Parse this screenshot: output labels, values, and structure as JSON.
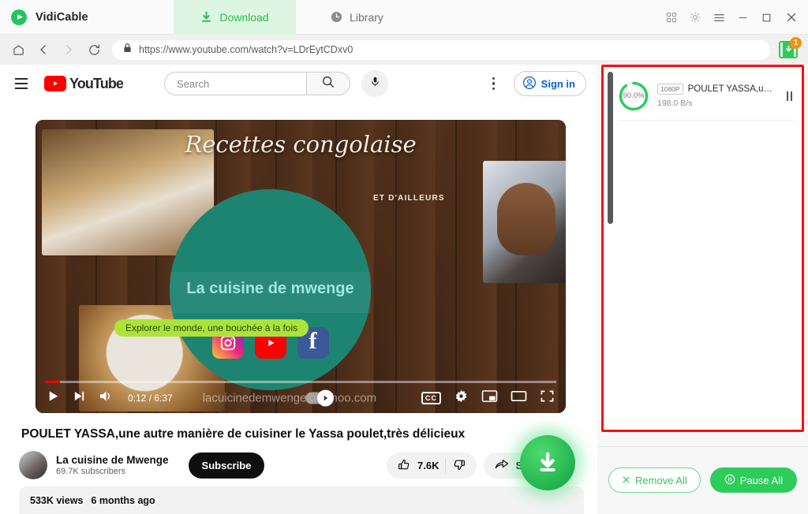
{
  "app": {
    "name": "VidiCable",
    "logo_icon": "vidicable-play-logo",
    "tabs": [
      {
        "label": "Download",
        "icon": "download-icon",
        "active": true
      },
      {
        "label": "Library",
        "icon": "clock-icon",
        "active": false
      }
    ],
    "window_controls": [
      {
        "name": "apps-grid-icon"
      },
      {
        "name": "gear-icon"
      },
      {
        "name": "hamburger-menu-icon"
      },
      {
        "name": "minimize-icon"
      },
      {
        "name": "maximize-icon"
      },
      {
        "name": "close-icon"
      }
    ]
  },
  "urlbar": {
    "home_icon": "home-icon",
    "back_icon": "back-arrow-icon",
    "forward_icon": "forward-arrow-icon",
    "reload_icon": "reload-icon",
    "lock_icon": "lock-icon",
    "url": "https://www.youtube.com/watch?v=LDrEytCDxv0",
    "download_icon": "film-download-icon",
    "download_badge": "1"
  },
  "youtube": {
    "logo_text": "YouTube",
    "search_placeholder": "Search",
    "sign_in_label": "Sign in"
  },
  "video": {
    "overlay": {
      "title": "Recettes congolaise",
      "subtitle": "ET D'AILLEURS",
      "channel_circle": "La cuisine de mwenge",
      "tagline": "Explorer le monde, une bouchée à la fois",
      "socials": [
        "instagram-icon",
        "youtube-icon",
        "facebook-icon"
      ]
    },
    "player": {
      "current_time": "0:12",
      "duration": "6:37",
      "time_display": "0:12 / 6:37",
      "progress_percent": 3,
      "watermark": "lacuicinedemwenge@yahoo.com",
      "controls": [
        "play-icon",
        "next-icon",
        "volume-icon",
        "autoplay-toggle",
        "cc-icon",
        "settings-gear-icon",
        "miniplayer-icon",
        "theater-icon",
        "fullscreen-icon"
      ],
      "cc_label": "CC"
    },
    "title": "POULET YASSA,une autre manière de cuisiner le Yassa poulet,très délicieux",
    "channel_name": "La cuisine de Mwenge",
    "subscribers": "69.7K subscribers",
    "subscribe_label": "Subscribe",
    "like_count": "7.6K",
    "share_label": "S",
    "views": "533K views",
    "published": "6 months ago"
  },
  "download_panel": {
    "item": {
      "progress": "90.0%",
      "progress_value": 90,
      "quality": "1080P",
      "name": "POULET YASSA,u…",
      "speed": "198.0 B/s",
      "pause_icon": "pause-icon"
    },
    "remove_all_label": "Remove All",
    "pause_all_label": "Pause All",
    "remove_icon": "close-x-icon",
    "pause_all_icon": "pause-circle-icon"
  },
  "colors": {
    "brand_green": "#35c759",
    "active_tab_bg": "#ddf6e1",
    "badge_orange": "#f79009",
    "youtube_red": "#ff0000",
    "signin_blue": "#065fd4",
    "highlight_red": "#fb0d0d"
  }
}
